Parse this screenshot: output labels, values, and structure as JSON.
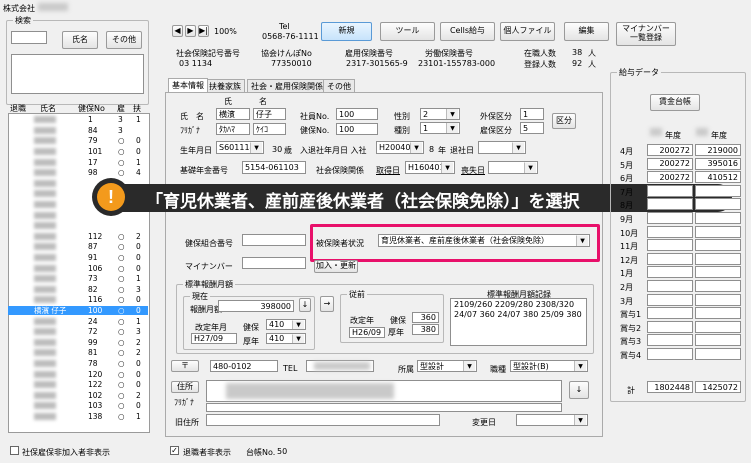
{
  "window": {
    "title": "株式会社"
  },
  "search": {
    "group_label": "検索",
    "name_button": "氏名",
    "other_button": "その他",
    "col_headers": [
      "退職",
      "氏名",
      "健保No",
      "雇",
      "扶"
    ],
    "rows": [
      {
        "no": "1",
        "koyo": "3",
        "fuyo": "1"
      },
      {
        "no": "84",
        "koyo": "3",
        "fuyo": ""
      },
      {
        "no": "79",
        "koyo": "○",
        "fuyo": "0"
      },
      {
        "no": "101",
        "koyo": "○",
        "fuyo": "0"
      },
      {
        "no": "17",
        "koyo": "○",
        "fuyo": "1"
      },
      {
        "no": "98",
        "koyo": "○",
        "fuyo": "4"
      },
      {
        "no": "",
        "koyo": "",
        "fuyo": ""
      },
      {
        "no": "",
        "koyo": "",
        "fuyo": ""
      },
      {
        "no": "",
        "koyo": "",
        "fuyo": ""
      },
      {
        "no": "",
        "koyo": "",
        "fuyo": ""
      },
      {
        "no": "",
        "koyo": "",
        "fuyo": ""
      },
      {
        "no": "112",
        "koyo": "○",
        "fuyo": "2"
      },
      {
        "no": "87",
        "koyo": "○",
        "fuyo": "0"
      },
      {
        "no": "91",
        "koyo": "○",
        "fuyo": "0"
      },
      {
        "no": "106",
        "koyo": "○",
        "fuyo": "0"
      },
      {
        "no": "73",
        "koyo": "○",
        "fuyo": "1"
      },
      {
        "no": "82",
        "koyo": "○",
        "fuyo": "3"
      },
      {
        "no": "116",
        "koyo": "○",
        "fuyo": "0"
      },
      {
        "no": "100",
        "koyo": "○",
        "fuyo": "0",
        "name": "横濱 仔子",
        "selected": true
      },
      {
        "no": "24",
        "koyo": "○",
        "fuyo": "1"
      },
      {
        "no": "72",
        "koyo": "○",
        "fuyo": "3"
      },
      {
        "no": "99",
        "koyo": "○",
        "fuyo": "2"
      },
      {
        "no": "81",
        "koyo": "○",
        "fuyo": "2"
      },
      {
        "no": "78",
        "koyo": "○",
        "fuyo": "0"
      },
      {
        "no": "120",
        "koyo": "○",
        "fuyo": "0"
      },
      {
        "no": "122",
        "koyo": "○",
        "fuyo": "0"
      },
      {
        "no": "102",
        "koyo": "○",
        "fuyo": "2"
      },
      {
        "no": "103",
        "koyo": "○",
        "fuyo": "0"
      },
      {
        "no": "138",
        "koyo": "○",
        "fuyo": "1"
      }
    ],
    "hide_insurance_check": "社保雇保非加入者非表示",
    "hide_retired_check": "退職者非表示",
    "ledger_label": "台帳No.",
    "ledger_no": "50"
  },
  "toolbar": {
    "zoom": "100%",
    "tel_label": "Tel",
    "tel_value": "0568-76-1111",
    "new_button": "新規",
    "tools_button": "ツール",
    "cells_button": "Cells給与",
    "personal_file_button": "個人ファイル",
    "edit_button": "編集",
    "mynumber_button": "マイナンバー\n一覧登録"
  },
  "company_info": {
    "labels": [
      "社会保険記号番号",
      "協会けんぽNo",
      "雇用保険番号",
      "労働保険番号"
    ],
    "values": [
      "03  1134",
      "77350010",
      "2317-301565-9",
      "23101-155783-000"
    ],
    "enrolled_label": "在職人数",
    "enrolled_value": "38",
    "registered_label": "登録人数",
    "registered_value": "92",
    "unit": "人"
  },
  "tabs": [
    "基本情報",
    "扶養家族",
    "社会・雇用保険関係",
    "その他"
  ],
  "basic": {
    "sei_label": "氏",
    "mei_label": "名",
    "name_label": "氏　名",
    "furigana_label": "ﾌﾘｶﾞﾅ",
    "sei": "横濱",
    "mei": "仔子",
    "sei_kana": "ﾀｶﾊﾏ",
    "mei_kana": "ｹｲｺ",
    "shain_label": "社員No.",
    "shain_no": "100",
    "kenpo_label": "健保No.",
    "kenpo_no": "100",
    "sex_label": "性別",
    "sex": "2",
    "kind_label": "種別",
    "kind": "1",
    "gaihoken_label": "外保区分",
    "gaihoken": "1",
    "koyo_kubun_label": "雇保区分",
    "koyo_kubun": "5",
    "kubun_button": "区分",
    "birth_label": "生年月日",
    "birth": "S601114",
    "age": "30",
    "age_unit": "歳",
    "join_label": "入退社年月日 入社",
    "join": "H200401",
    "tenure": "8",
    "tenure_unit": "年",
    "retire_label": "退社日",
    "pension_label": "基礎年金番号",
    "pension": "5154-061103",
    "shaho_label": "社会保険関係",
    "shutoku_label": "取得日",
    "shutoku": "H160401",
    "soshitsu_label": "喪失日",
    "kenpo_kumiai_label": "健保組合番号",
    "insured_status_label": "被保険者状況",
    "insured_status": "育児休業者、産前産後休業者（社会保険免除）",
    "mynumber_label": "マイナンバー",
    "update_button": "加入・更新"
  },
  "callout": {
    "text": "「育児休業者、産前産後休業者（社会保険免除）」を選択",
    "icon": "!"
  },
  "standard": {
    "group_label": "標準報酬月額",
    "current_label": "現在",
    "monthly_label": "報酬月額",
    "monthly": "398000",
    "revision_label": "改定年月",
    "revision": "H27/09",
    "kenpo_label": "健保",
    "kenpo": "410",
    "kosei_label": "厚年",
    "kosei": "410",
    "history_label": "従前",
    "hist_revision_label": "改定年",
    "hist_revision": "H26/09",
    "hist_kenpo_label": "健保",
    "hist_kenpo": "360",
    "hist_kosei_label": "厚年",
    "hist_kosei": "380",
    "record_label": "標準報酬月額記録",
    "record_text": "2109/260 2209/280 2308/320 24/07 360 24/07 380 25/09 380"
  },
  "address": {
    "zip_button": "〒",
    "zip": "480-0102",
    "tel_label": "TEL",
    "dept_label": "所属",
    "dept": "型設計",
    "role_label": "職種",
    "role": "型設計(B)",
    "addr_button": "住所",
    "furigana_label": "ﾌﾘｶﾞﾅ",
    "old_addr_label": "旧住所",
    "change_date_label": "変更日"
  },
  "salary": {
    "group_label": "給与データ",
    "ledger_button": "賃金台帳",
    "year_header": "年度",
    "months": [
      "4月",
      "5月",
      "6月",
      "7月",
      "8月",
      "9月",
      "10月",
      "11月",
      "12月",
      "1月",
      "2月",
      "3月",
      "賞与1",
      "賞与2",
      "賞与3",
      "賞与4"
    ],
    "col1": [
      "200272",
      "200272",
      "200272",
      "",
      "",
      "",
      "",
      "",
      "",
      "",
      "",
      "",
      "",
      "",
      "",
      ""
    ],
    "col2": [
      "219000",
      "395016",
      "410512",
      "",
      "",
      "",
      "",
      "",
      "",
      "",
      "",
      "",
      "",
      "",
      "",
      ""
    ],
    "total_label": "計",
    "total1": "1802448",
    "total2": "1425072"
  }
}
